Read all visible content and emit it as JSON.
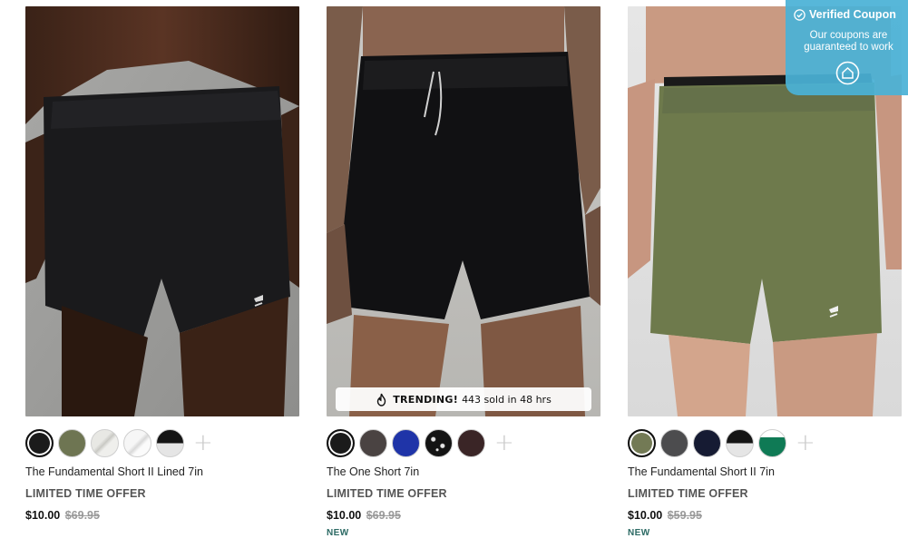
{
  "products": [
    {
      "name": "The Fundamental Short II Lined 7in",
      "offer": "LIMITED TIME OFFER",
      "price": "$10.00",
      "original_price": "$69.95",
      "badge": "",
      "swatches": [
        "black",
        "olive",
        "light-gray-pattern",
        "white-pattern",
        "black-white-pattern"
      ],
      "more_swatches_icon": "plus-icon"
    },
    {
      "name": "The One Short 7in",
      "offer": "LIMITED TIME OFFER",
      "price": "$10.00",
      "original_price": "$69.95",
      "badge": "NEW",
      "trending": {
        "label": "TRENDING!",
        "text": "443 sold in 48 hrs",
        "icon": "flame-icon"
      },
      "swatches": [
        "black",
        "charcoal-brown",
        "royal-blue",
        "black-speckle",
        "dark-brown"
      ],
      "more_swatches_icon": "plus-icon"
    },
    {
      "name": "The Fundamental Short II 7in",
      "offer": "LIMITED TIME OFFER",
      "price": "$10.00",
      "original_price": "$59.95",
      "badge": "NEW",
      "swatches": [
        "olive",
        "charcoal",
        "navy",
        "black-white-pattern",
        "green-white"
      ],
      "more_swatches_icon": "plus-icon"
    }
  ],
  "coupon": {
    "title": "Verified Coupon",
    "subtitle": "Our coupons are guaranteed to work",
    "icon": "home-icon",
    "check_icon": "check-circle-icon"
  },
  "colors": {
    "coupon_bg": "#4ab2d6",
    "new_badge": "#2c6a64",
    "strike_price": "#9a9a9a"
  }
}
